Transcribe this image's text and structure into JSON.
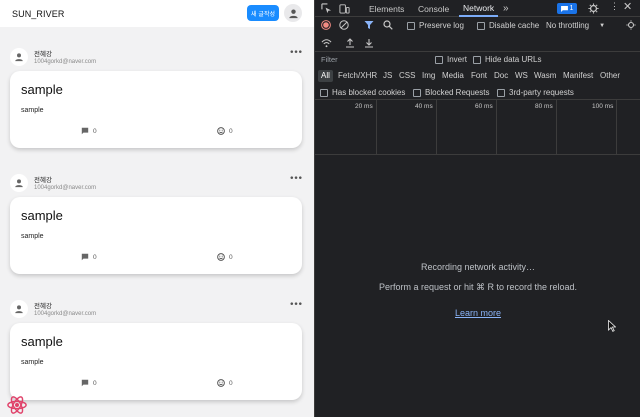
{
  "app": {
    "title": "SUN_RIVER",
    "new_post_label": "새 글작성",
    "posts": [
      {
        "author_name": "전혜강",
        "author_email": "1004gorkd@naver.com",
        "title": "sample",
        "body": "sample",
        "comments": "0",
        "likes": "0"
      },
      {
        "author_name": "전혜강",
        "author_email": "1004gorkd@naver.com",
        "title": "sample",
        "body": "sample",
        "comments": "0",
        "likes": "0"
      },
      {
        "author_name": "전혜강",
        "author_email": "1004gorkd@naver.com",
        "title": "sample",
        "body": "sample",
        "comments": "0",
        "likes": "0"
      }
    ],
    "more_label": "•••"
  },
  "devtools": {
    "tabs": [
      "Elements",
      "Console",
      "Network"
    ],
    "active_tab": "Network",
    "more_tabs": "»",
    "issues_count": "1",
    "preserve_log": "Preserve log",
    "disable_cache": "Disable cache",
    "throttling": "No throttling",
    "filter_placeholder": "Filter",
    "invert": "Invert",
    "hide_data_urls": "Hide data URLs",
    "types": [
      "All",
      "Fetch/XHR",
      "JS",
      "CSS",
      "Img",
      "Media",
      "Font",
      "Doc",
      "WS",
      "Wasm",
      "Manifest",
      "Other"
    ],
    "has_blocked_cookies": "Has blocked cookies",
    "blocked_requests": "Blocked Requests",
    "third_party": "3rd-party requests",
    "ticks": [
      "20 ms",
      "40 ms",
      "60 ms",
      "80 ms",
      "100 ms"
    ],
    "empty_line1": "Recording network activity…",
    "empty_line2": "Perform a request or hit ⌘ R to record the reload.",
    "learn_more": "Learn more"
  },
  "colors": {
    "accent": "#1a8cff",
    "devtools_bg": "#202124",
    "record_red": "#f28b82",
    "link": "#8ab4f8"
  }
}
